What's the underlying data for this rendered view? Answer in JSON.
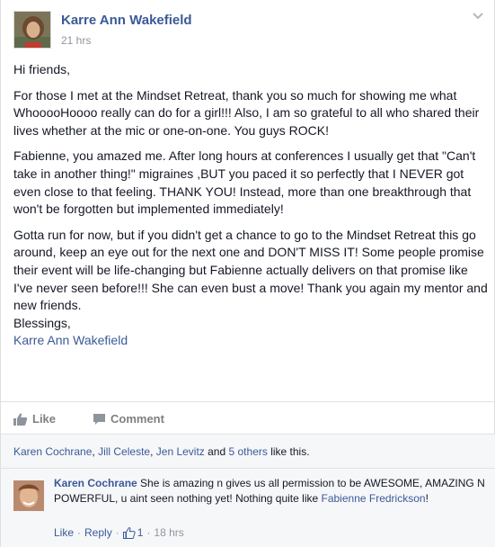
{
  "post": {
    "author": "Karre Ann Wakefield",
    "time": "21 hrs",
    "paragraphs": [
      "Hi friends,",
      "For those I met at the Mindset Retreat, thank you so much for showing me what WhooooHoooo really can do for a girl!!! Also, I am so grateful to all who shared their lives whether at the mic or one-on-one. You guys ROCK!",
      "Fabienne, you amazed me. After long hours at conferences I usually get that \"Can't take in another thing!\" migraines ,BUT you paced it so perfectly that I NEVER got even close to that feeling. THANK YOU! Instead, more than one breakthrough that won't be forgotten but implemented immediately!",
      "Gotta run for now, but if you didn't get a chance to go to the Mindset Retreat this go around, keep an eye out for the next one and DON'T MISS IT! Some people promise their event will be life-changing but Fabienne actually delivers on that promise like I've never seen before!!! She can even bust a move! Thank you again my mentor and new friends."
    ],
    "closing": "Blessings,",
    "signature": "Karre Ann Wakefield"
  },
  "actions": {
    "like": "Like",
    "comment": "Comment"
  },
  "likes": {
    "names": [
      "Karen Cochrane",
      "Jill Celeste",
      "Jen Levitz"
    ],
    "sep1": ", ",
    "sep2": ", ",
    "and_text": " and ",
    "others": "5 others",
    "suffix": " like this."
  },
  "comment": {
    "author": "Karen Cochrane",
    "text": " She is amazing n gives us all permission to be AWESOME, AMAZING N POWERFUL, u aint seen nothing yet! Nothing quite like ",
    "mention": "Fabienne Fredrickson",
    "text_end": "!",
    "like": "Like",
    "reply": "Reply",
    "like_count": "1",
    "dot": "·",
    "time": "18 hrs"
  },
  "icons": {
    "chevron": "chevron-down-icon",
    "like": "thumbs-up-icon",
    "comment": "speech-bubble-icon"
  },
  "colors": {
    "link": "#3b5998",
    "muted": "#90949c",
    "text": "#141823",
    "action": "#7f7f7f",
    "panel": "#f6f7f9"
  }
}
